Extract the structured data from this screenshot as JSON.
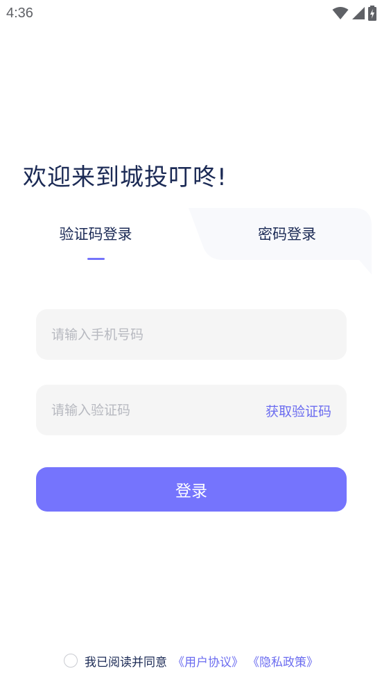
{
  "status_bar": {
    "time": "4:36",
    "icons": [
      "wifi-icon",
      "cell-signal-icon",
      "battery-charging-icon"
    ]
  },
  "welcome_title": "欢迎来到城投叮咚!",
  "tabs": {
    "sms_login": "验证码登录",
    "password_login": "密码登录",
    "active": "sms_login"
  },
  "form": {
    "phone_placeholder": "请输入手机号码",
    "phone_value": "",
    "code_placeholder": "请输入验证码",
    "code_value": "",
    "get_code_label": "获取验证码"
  },
  "login_button": "登录",
  "agreement": {
    "checked": false,
    "text": "我已阅读并同意",
    "user_agreement": "《用户协议》",
    "privacy_policy": "《隐私政策》"
  },
  "colors": {
    "accent": "#7574fd",
    "link": "#6b6cf0",
    "text_primary": "#1b2a55",
    "placeholder": "#b7b9c0",
    "field_bg": "#f5f5f5",
    "inactive_tab_bg": "#f8f9fc"
  }
}
